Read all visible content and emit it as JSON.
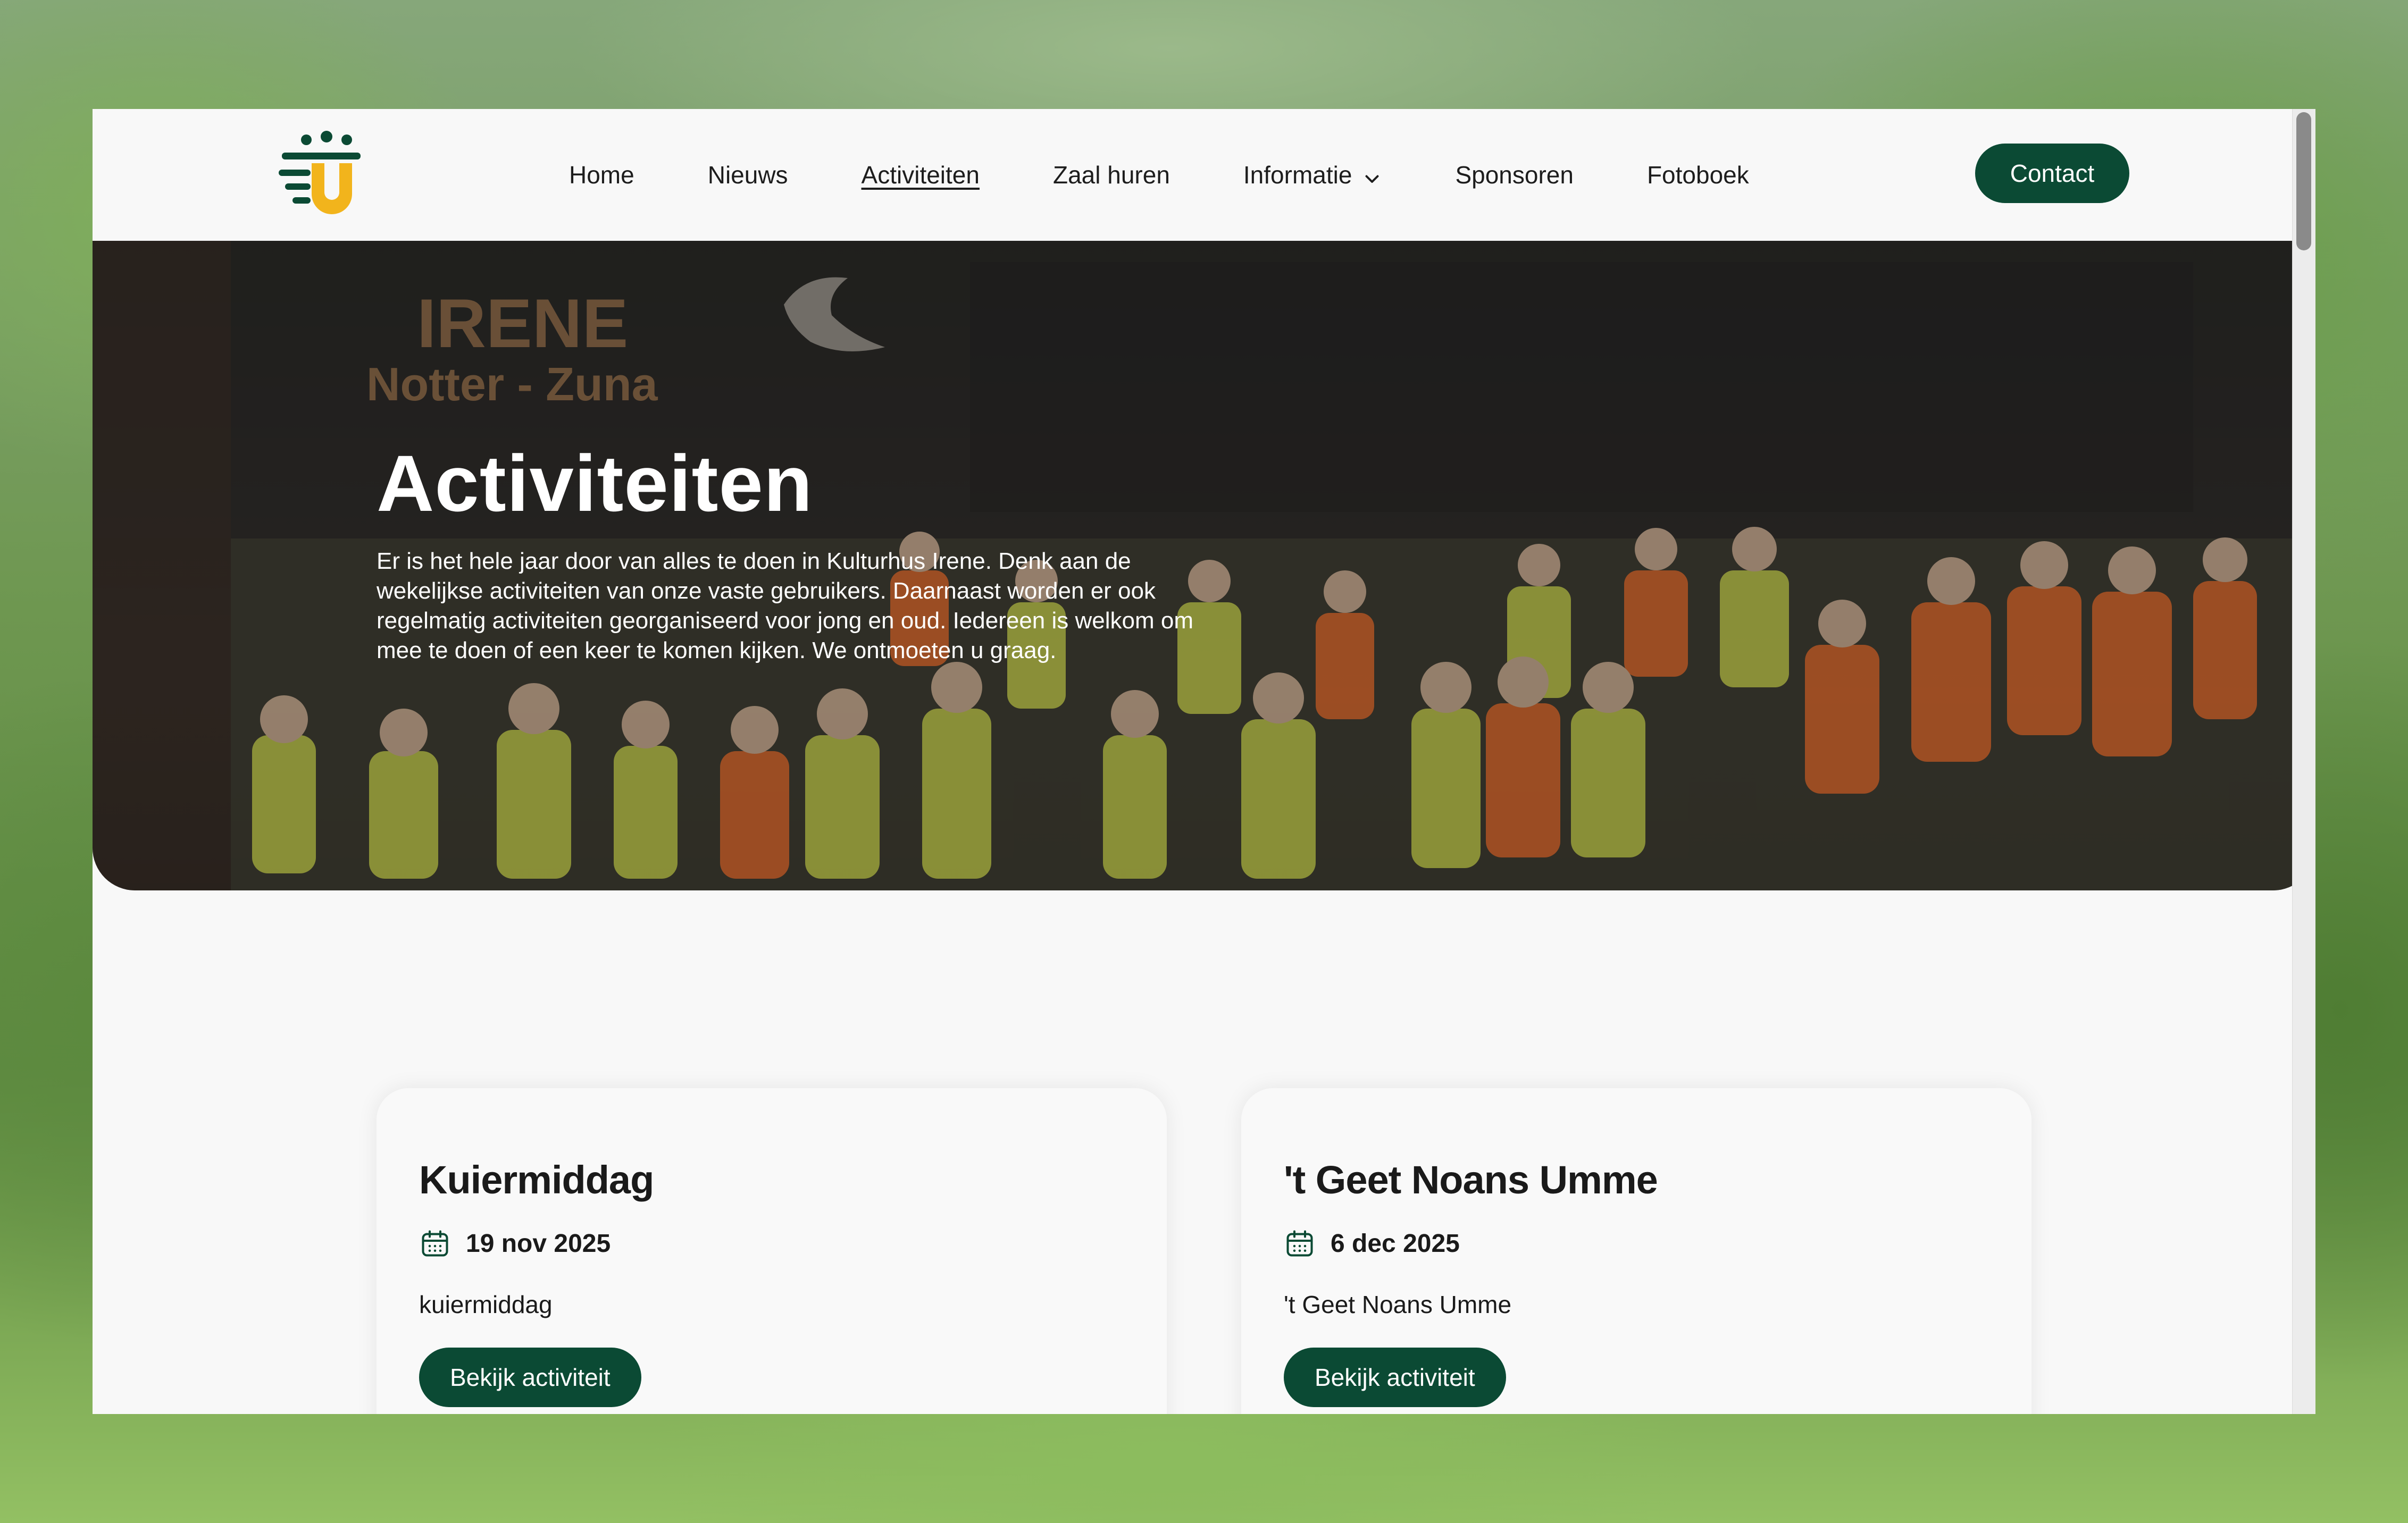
{
  "nav": {
    "items": [
      {
        "label": "Home",
        "active": false
      },
      {
        "label": "Nieuws",
        "active": false
      },
      {
        "label": "Activiteiten",
        "active": true
      },
      {
        "label": "Zaal huren",
        "active": false
      },
      {
        "label": "Informatie",
        "active": false,
        "has_dropdown": true
      },
      {
        "label": "Sponsoren",
        "active": false
      },
      {
        "label": "Fotoboek",
        "active": false
      }
    ],
    "contact_label": "Contact"
  },
  "hero": {
    "title": "Activiteiten",
    "text": "Er is het hele jaar door van alles te doen in Kulturhus Irene. Denk aan de wekelijkse activiteiten van onze vaste gebruikers. Daarnaast worden er ook regelmatig activiteiten georganiseerd voor jong en oud. Iedereen is welkom om mee te doen of een keer te komen kijken. We ontmoeten u graag.",
    "sign_line1": "IRENE",
    "sign_line2": "Notter - Zuna"
  },
  "activities": [
    {
      "title": "Kuiermiddag",
      "date": "19 nov 2025",
      "description": "kuiermiddag",
      "button_label": "Bekijk activiteit"
    },
    {
      "title": "'t Geet Noans Umme",
      "date": "6 dec 2025",
      "description": "'t Geet Noans Umme",
      "button_label": "Bekijk activiteit"
    }
  ],
  "colors": {
    "brand_green": "#0b4a34",
    "brand_yellow": "#f2b41c",
    "page_bg": "#f8f8f8"
  },
  "icons": {
    "logo": "kulturhus-logo-icon",
    "dropdown": "chevron-down-icon",
    "date": "calendar-icon"
  }
}
